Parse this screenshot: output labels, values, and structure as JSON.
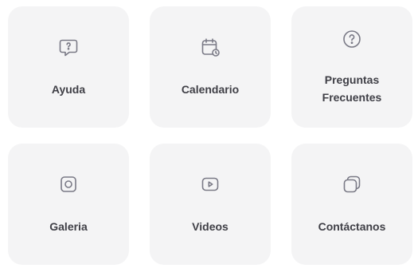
{
  "tiles": [
    {
      "label": "Ayuda",
      "icon": "help-chat-icon"
    },
    {
      "label": "Calendario",
      "icon": "calendar-icon"
    },
    {
      "label": "Preguntas Frecuentes",
      "icon": "question-circle-icon"
    },
    {
      "label": "Galeria",
      "icon": "image-gallery-icon"
    },
    {
      "label": "Videos",
      "icon": "video-play-icon"
    },
    {
      "label": "Contáctanos",
      "icon": "contact-cards-icon"
    }
  ],
  "colors": {
    "tile_background": "#f4f4f5",
    "icon": "#7a7a86",
    "label": "#3f3f46"
  }
}
